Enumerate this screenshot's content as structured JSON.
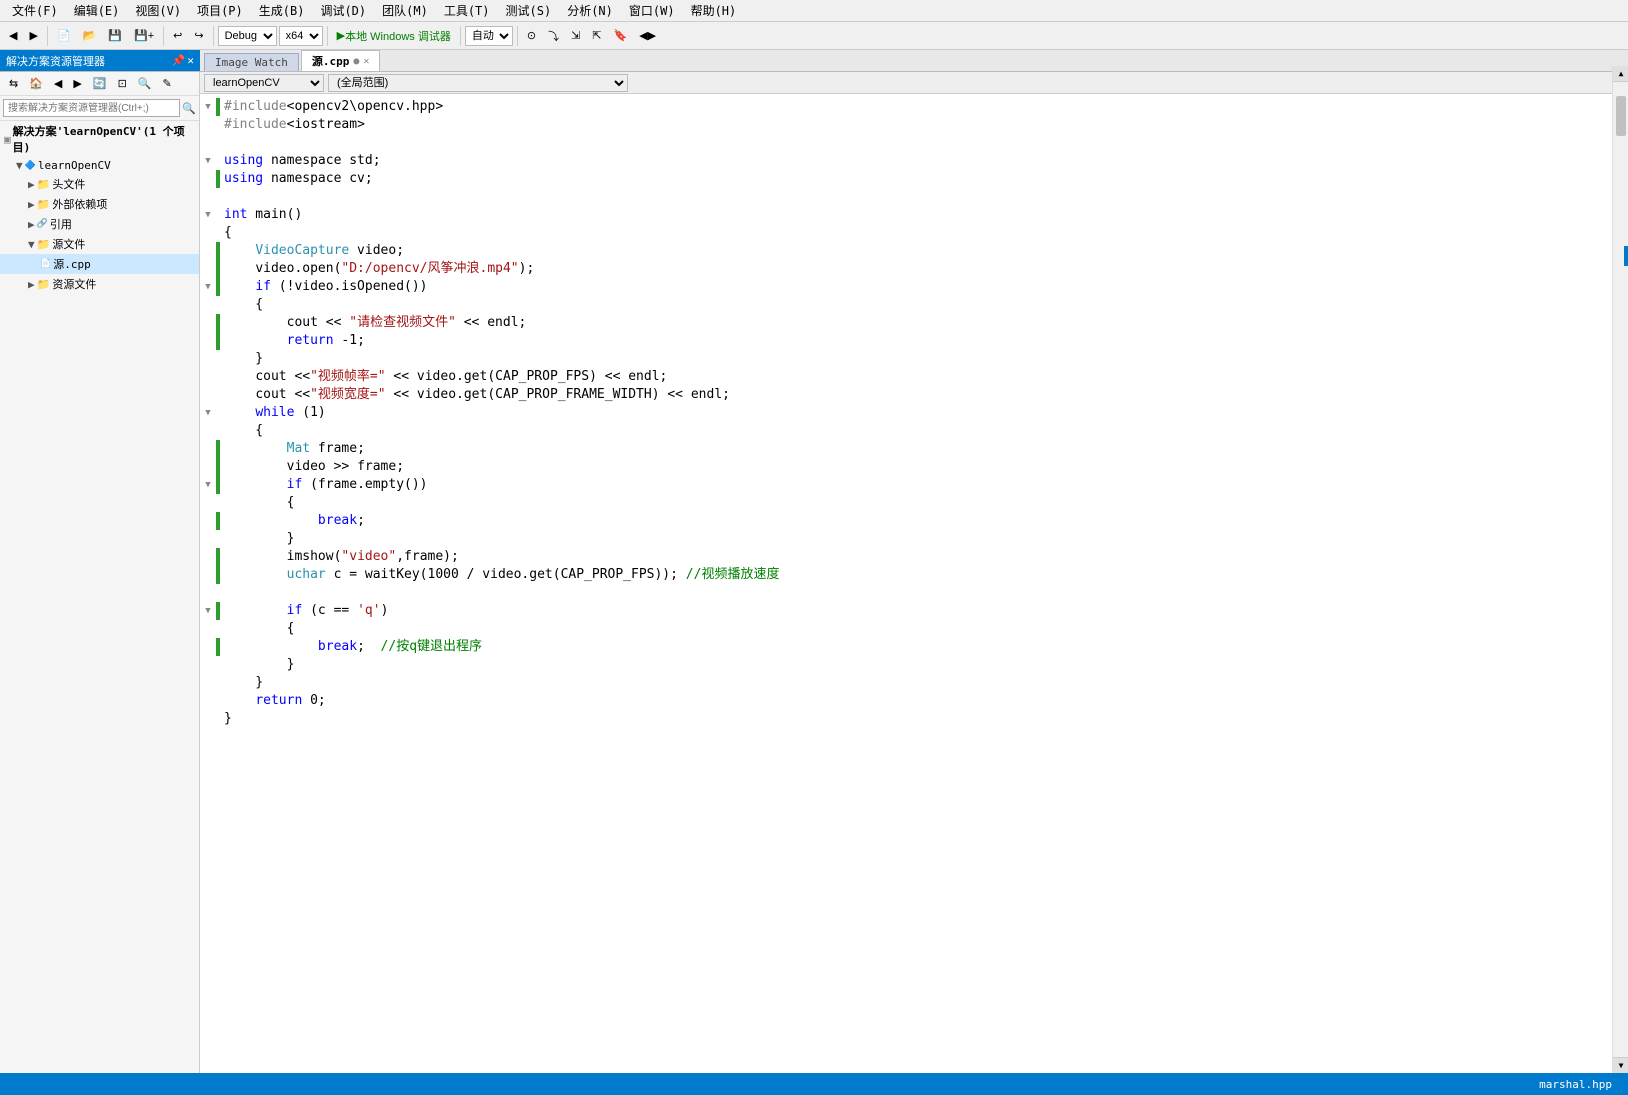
{
  "menubar": {
    "items": [
      "文件(F)",
      "编辑(E)",
      "视图(V)",
      "项目(P)",
      "生成(B)",
      "调试(D)",
      "团队(M)",
      "工具(T)",
      "测试(S)",
      "分析(N)",
      "窗口(W)",
      "帮助(H)"
    ]
  },
  "toolbar": {
    "debug_config": "Debug",
    "platform": "x64",
    "run_label": "本地 Windows 调试器",
    "mode_label": "自动"
  },
  "tabs": {
    "image_watch": "Image Watch",
    "source_file": "源.cpp",
    "active": "源.cpp"
  },
  "sidebar": {
    "header": "解决方案资源管理器",
    "search_placeholder": "搜索解决方案资源管理器(Ctrl+;)",
    "solution_label": "解决方案'learnOpenCV'(1 个项目)",
    "project": "learnOpenCV",
    "items": [
      {
        "label": "头文件",
        "indent": 2,
        "type": "folder"
      },
      {
        "label": "外部依赖项",
        "indent": 2,
        "type": "folder"
      },
      {
        "label": "引用",
        "indent": 2,
        "type": "folder"
      },
      {
        "label": "源文件",
        "indent": 2,
        "type": "folder"
      },
      {
        "label": "源.cpp",
        "indent": 3,
        "type": "file"
      },
      {
        "label": "资源文件",
        "indent": 2,
        "type": "folder"
      }
    ]
  },
  "editor": {
    "file_selector": "learnOpenCV",
    "scope_selector": "(全局范围)",
    "lines": [
      {
        "num": "",
        "fold": "▼",
        "green": true,
        "code": "#include<opencv2\\opencv.hpp>",
        "parts": [
          {
            "text": "#include",
            "cls": "preprocessor"
          },
          {
            "text": "<opencv2\\opencv.hpp>",
            "cls": ""
          }
        ]
      },
      {
        "num": "",
        "fold": "",
        "green": false,
        "code": "#include<iostream>",
        "parts": [
          {
            "text": "#include",
            "cls": "preprocessor"
          },
          {
            "text": "<iostream>",
            "cls": ""
          }
        ]
      },
      {
        "num": "",
        "fold": "",
        "green": false,
        "code": ""
      },
      {
        "num": "",
        "fold": "▼",
        "green": false,
        "code": "using namespace std;"
      },
      {
        "num": "",
        "fold": "",
        "green": true,
        "code": "using namespace cv;"
      },
      {
        "num": "",
        "fold": "",
        "green": false,
        "code": ""
      },
      {
        "num": "",
        "fold": "▼",
        "green": false,
        "code": "int main()"
      },
      {
        "num": "",
        "fold": "",
        "green": false,
        "code": "{"
      },
      {
        "num": "",
        "fold": "",
        "green": true,
        "code": "    VideoCapture video;"
      },
      {
        "num": "",
        "fold": "",
        "green": true,
        "code": "    video.open(\"D:/opencv/风筝冲浪.mp4\");"
      },
      {
        "num": "",
        "fold": "▼",
        "green": true,
        "code": "    if (!video.isOpened())"
      },
      {
        "num": "",
        "fold": "",
        "green": false,
        "code": "    {"
      },
      {
        "num": "",
        "fold": "",
        "green": true,
        "code": "        cout << \"请检查视频文件\" << endl;"
      },
      {
        "num": "",
        "fold": "",
        "green": true,
        "code": "        return -1;"
      },
      {
        "num": "",
        "fold": "",
        "green": false,
        "code": "    }"
      },
      {
        "num": "",
        "fold": "",
        "green": false,
        "code": "    cout <<\"视频帧率=\" << video.get(CAP_PROP_FPS) << endl;"
      },
      {
        "num": "",
        "fold": "",
        "green": false,
        "code": "    cout <<\"视频宽度=\" << video.get(CAP_PROP_FRAME_WIDTH) << endl;"
      },
      {
        "num": "",
        "fold": "▼",
        "green": false,
        "code": "    while (1)"
      },
      {
        "num": "",
        "fold": "",
        "green": false,
        "code": "    {"
      },
      {
        "num": "",
        "fold": "",
        "green": true,
        "code": "        Mat frame;"
      },
      {
        "num": "",
        "fold": "",
        "green": true,
        "code": "        video >> frame;"
      },
      {
        "num": "",
        "fold": "▼",
        "green": true,
        "code": "        if (frame.empty())"
      },
      {
        "num": "",
        "fold": "",
        "green": false,
        "code": "        {"
      },
      {
        "num": "",
        "fold": "",
        "green": true,
        "code": "            break;"
      },
      {
        "num": "",
        "fold": "",
        "green": false,
        "code": "        }"
      },
      {
        "num": "",
        "fold": "",
        "green": true,
        "code": "        imshow(\"video\",frame);"
      },
      {
        "num": "",
        "fold": "",
        "green": true,
        "code": "        uchar c = waitKey(1000 / video.get(CAP_PROP_FPS)); //视频播放速度"
      },
      {
        "num": "",
        "fold": "",
        "green": false,
        "code": ""
      },
      {
        "num": "",
        "fold": "▼",
        "green": true,
        "code": "        if (c == 'q')"
      },
      {
        "num": "",
        "fold": "",
        "green": false,
        "code": "        {"
      },
      {
        "num": "",
        "fold": "",
        "green": true,
        "code": "            break;  //按q键退出程序"
      },
      {
        "num": "",
        "fold": "",
        "green": false,
        "code": "        }"
      },
      {
        "num": "",
        "fold": "",
        "green": false,
        "code": "    }"
      },
      {
        "num": "",
        "fold": "",
        "green": false,
        "code": "    return 0;"
      },
      {
        "num": "",
        "fold": "",
        "green": false,
        "code": "}"
      }
    ]
  },
  "statusbar": {
    "right_item": "marshal.hpp"
  }
}
